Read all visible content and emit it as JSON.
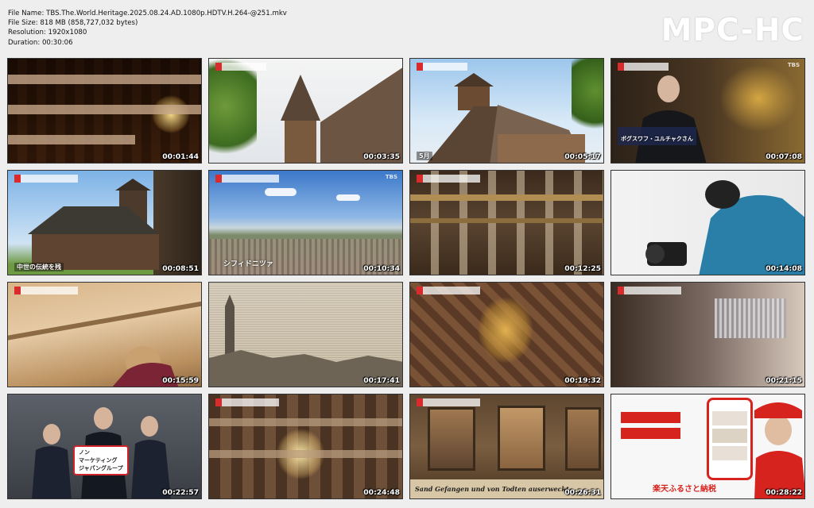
{
  "file_info": {
    "name": "File Name: TBS.The.World.Heritage.2025.08.24.AD.1080p.HDTV.H.264-@251.mkv",
    "size": "File Size: 818 MB (858,727,032 bytes)",
    "resolution": "Resolution: 1920x1080",
    "duration": "Duration: 00:30:06"
  },
  "brand": "MPC-HC",
  "thumbnails": [
    {
      "time": "00:01:44"
    },
    {
      "time": "00:03:35"
    },
    {
      "time": "00:05:17",
      "caption": "5月"
    },
    {
      "time": "00:07:08",
      "caption": "ボグスワフ・ユルチャクさん"
    },
    {
      "time": "00:08:51",
      "caption": "中世の伝統を残"
    },
    {
      "time": "00:10:34",
      "caption": "シフィドニツァ"
    },
    {
      "time": "00:12:25"
    },
    {
      "time": "00:14:08"
    },
    {
      "time": "00:15:59"
    },
    {
      "time": "00:17:41"
    },
    {
      "time": "00:19:32"
    },
    {
      "time": "00:21:15"
    },
    {
      "time": "00:22:57",
      "menu": [
        "ノン",
        "マーケティング",
        "ジャパングループ"
      ]
    },
    {
      "time": "00:24:48"
    },
    {
      "time": "00:26:31",
      "caption": "Sand Gefangen  und von Todten auserweckt"
    },
    {
      "time": "00:28:22",
      "caption": "楽天ふるさと納税"
    }
  ]
}
